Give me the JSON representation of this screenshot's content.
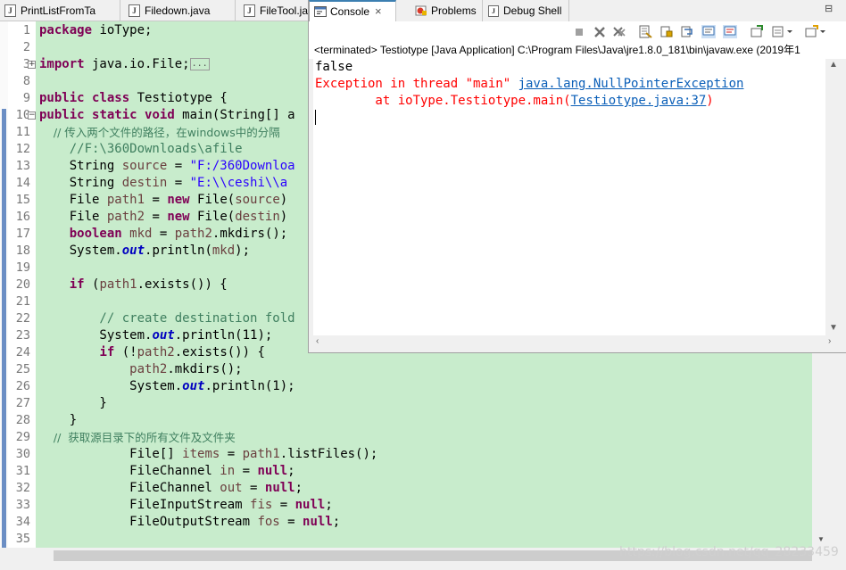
{
  "editor_tabs": [
    {
      "label": "PrintListFromTa"
    },
    {
      "label": "Filedown.java"
    },
    {
      "label": "FileTool.ja"
    }
  ],
  "view_tabs": {
    "console": "Console",
    "problems": "Problems",
    "debug_shell": "Debug Shell"
  },
  "console": {
    "header": "<terminated> Testiotype [Java Application] C:\\Program Files\\Java\\jre1.8.0_181\\bin\\javaw.exe (2019年1",
    "line1": "false",
    "line2_prefix": "Exception in thread \"main\" ",
    "line2_link": "java.lang.NullPointerException",
    "line3_prefix": "        at ioType.Testiotype.main(",
    "line3_link": "Testiotype.java:37",
    "line3_suffix": ")"
  },
  "line_numbers": [
    "1",
    "2",
    "3",
    "8",
    "9",
    "10",
    "11",
    "12",
    "13",
    "14",
    "15",
    "16",
    "17",
    "18",
    "19",
    "20",
    "21",
    "22",
    "23",
    "24",
    "25",
    "26",
    "27",
    "28",
    "29",
    "30",
    "31",
    "32",
    "33",
    "34",
    "35"
  ],
  "code": [
    {
      "ln": "1",
      "tokens": [
        {
          "t": "package",
          "c": "kw"
        },
        {
          "t": " ioType;"
        }
      ]
    },
    {
      "ln": "2",
      "tokens": []
    },
    {
      "ln": "3",
      "tokens": [
        {
          "t": "import",
          "c": "kw"
        },
        {
          "t": " java.io.File;"
        },
        {
          "t": "...",
          "c": "foldbox"
        }
      ]
    },
    {
      "ln": "8",
      "tokens": []
    },
    {
      "ln": "9",
      "tokens": [
        {
          "t": "public",
          "c": "kw"
        },
        {
          "t": " "
        },
        {
          "t": "class",
          "c": "kw"
        },
        {
          "t": " Testiotype {"
        }
      ]
    },
    {
      "ln": "10",
      "tokens": [
        {
          "t": "public",
          "c": "kw"
        },
        {
          "t": " "
        },
        {
          "t": "static",
          "c": "kw"
        },
        {
          "t": " "
        },
        {
          "t": "void",
          "c": "kw"
        },
        {
          "t": " main(String[] a"
        }
      ]
    },
    {
      "ln": "11",
      "cjk": true,
      "tokens": [
        {
          "t": "    // 传入两个文件的路径，在windows中的分隔",
          "c": "cm"
        }
      ]
    },
    {
      "ln": "12",
      "tokens": [
        {
          "t": "    //F:\\360Downloads\\afile",
          "c": "cm"
        }
      ]
    },
    {
      "ln": "13",
      "tokens": [
        {
          "t": "    String "
        },
        {
          "t": "source",
          "c": "vr"
        },
        {
          "t": " = "
        },
        {
          "t": "\"F:/360Downloa",
          "c": "str"
        }
      ]
    },
    {
      "ln": "14",
      "tokens": [
        {
          "t": "    String "
        },
        {
          "t": "destin",
          "c": "vr"
        },
        {
          "t": " = "
        },
        {
          "t": "\"E:\\\\ceshi\\\\a",
          "c": "str"
        }
      ]
    },
    {
      "ln": "15",
      "tokens": [
        {
          "t": "    File "
        },
        {
          "t": "path1",
          "c": "vr"
        },
        {
          "t": " = "
        },
        {
          "t": "new",
          "c": "kw"
        },
        {
          "t": " File("
        },
        {
          "t": "source",
          "c": "vr"
        },
        {
          "t": ")"
        }
      ]
    },
    {
      "ln": "16",
      "tokens": [
        {
          "t": "    File "
        },
        {
          "t": "path2",
          "c": "vr"
        },
        {
          "t": " = "
        },
        {
          "t": "new",
          "c": "kw"
        },
        {
          "t": " File("
        },
        {
          "t": "destin",
          "c": "vr"
        },
        {
          "t": ")"
        }
      ]
    },
    {
      "ln": "17",
      "tokens": [
        {
          "t": "    "
        },
        {
          "t": "boolean",
          "c": "kw"
        },
        {
          "t": " "
        },
        {
          "t": "mkd",
          "c": "vr"
        },
        {
          "t": " = "
        },
        {
          "t": "path2",
          "c": "vr"
        },
        {
          "t": ".mkdirs();"
        }
      ]
    },
    {
      "ln": "18",
      "tokens": [
        {
          "t": "    System."
        },
        {
          "t": "out",
          "c": "fld"
        },
        {
          "t": ".println("
        },
        {
          "t": "mkd",
          "c": "vr"
        },
        {
          "t": ");"
        }
      ]
    },
    {
      "ln": "19",
      "tokens": []
    },
    {
      "ln": "20",
      "tokens": [
        {
          "t": "    "
        },
        {
          "t": "if",
          "c": "kw"
        },
        {
          "t": " ("
        },
        {
          "t": "path1",
          "c": "vr"
        },
        {
          "t": ".exists()) {"
        }
      ]
    },
    {
      "ln": "21",
      "tokens": []
    },
    {
      "ln": "22",
      "tokens": [
        {
          "t": "        // create destination fold",
          "c": "cm"
        }
      ]
    },
    {
      "ln": "23",
      "tokens": [
        {
          "t": "        System."
        },
        {
          "t": "out",
          "c": "fld"
        },
        {
          "t": ".println(11);"
        }
      ]
    },
    {
      "ln": "24",
      "tokens": [
        {
          "t": "        "
        },
        {
          "t": "if",
          "c": "kw"
        },
        {
          "t": " (!"
        },
        {
          "t": "path2",
          "c": "vr"
        },
        {
          "t": ".exists()) {"
        }
      ]
    },
    {
      "ln": "25",
      "tokens": [
        {
          "t": "            "
        },
        {
          "t": "path2",
          "c": "vr"
        },
        {
          "t": ".mkdirs();"
        }
      ]
    },
    {
      "ln": "26",
      "tokens": [
        {
          "t": "            System."
        },
        {
          "t": "out",
          "c": "fld"
        },
        {
          "t": ".println(1);"
        }
      ]
    },
    {
      "ln": "27",
      "tokens": [
        {
          "t": "        }"
        }
      ]
    },
    {
      "ln": "28",
      "tokens": [
        {
          "t": "    }"
        }
      ]
    },
    {
      "ln": "29",
      "cjk": true,
      "tokens": [
        {
          "t": "    //  获取源目录下的所有文件及文件夹",
          "c": "cm"
        }
      ]
    },
    {
      "ln": "30",
      "tokens": [
        {
          "t": "            File[] "
        },
        {
          "t": "items",
          "c": "vr"
        },
        {
          "t": " = "
        },
        {
          "t": "path1",
          "c": "vr"
        },
        {
          "t": ".listFiles();"
        }
      ]
    },
    {
      "ln": "31",
      "tokens": [
        {
          "t": "            FileChannel "
        },
        {
          "t": "in",
          "c": "vr"
        },
        {
          "t": " = "
        },
        {
          "t": "null",
          "c": "kw"
        },
        {
          "t": ";"
        }
      ]
    },
    {
      "ln": "32",
      "tokens": [
        {
          "t": "            FileChannel "
        },
        {
          "t": "out",
          "c": "vr"
        },
        {
          "t": " = "
        },
        {
          "t": "null",
          "c": "kw"
        },
        {
          "t": ";"
        }
      ]
    },
    {
      "ln": "33",
      "tokens": [
        {
          "t": "            FileInputStream "
        },
        {
          "t": "fis",
          "c": "vr"
        },
        {
          "t": " = "
        },
        {
          "t": "null",
          "c": "kw"
        },
        {
          "t": ";"
        }
      ]
    },
    {
      "ln": "34",
      "tokens": [
        {
          "t": "            FileOutputStream "
        },
        {
          "t": "fos",
          "c": "vr"
        },
        {
          "t": " = "
        },
        {
          "t": "null",
          "c": "kw"
        },
        {
          "t": ";"
        }
      ]
    },
    {
      "ln": "35",
      "tokens": []
    }
  ],
  "watermark": "https://blog.csdn.net/qq_28233459",
  "icons": {
    "java_file": "J",
    "fold_expanded": "−",
    "fold_collapsed": "+",
    "close": "×",
    "maximize": "⊟"
  },
  "colors": {
    "keyword": "#7f0055",
    "string": "#2a00ff",
    "comment": "#3f7f5f",
    "error": "#ff0000",
    "link": "#0b5fb8",
    "code_highlight": "#c8eccc"
  }
}
